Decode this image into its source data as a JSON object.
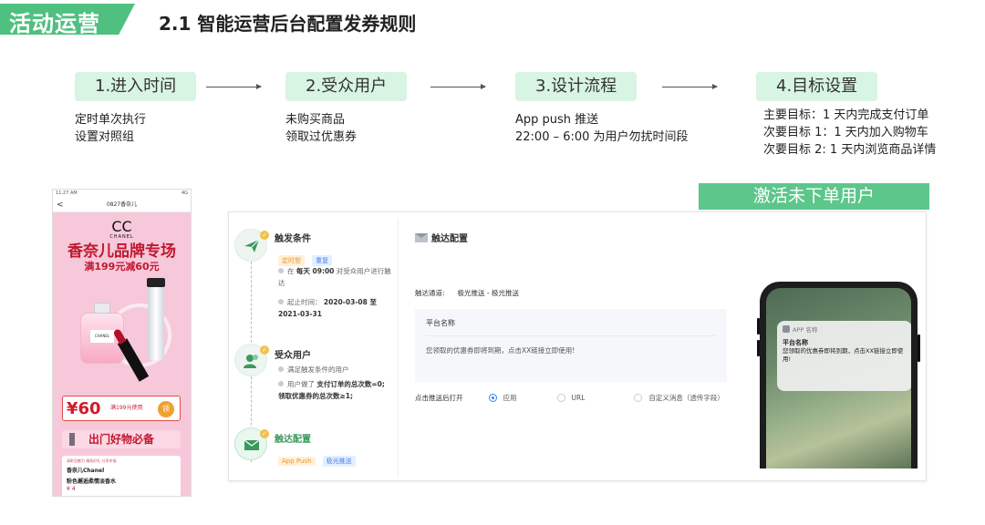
{
  "header": {
    "section_tag": "活动运营",
    "title": "2.1 智能运营后台配置发券规则"
  },
  "steps": [
    {
      "label": "1.进入时间",
      "lines": [
        "定时单次执行",
        "设置对照组"
      ]
    },
    {
      "label": "2.受众用户",
      "lines": [
        "未购买商品",
        "领取过优惠券"
      ]
    },
    {
      "label": "3.设计流程",
      "lines": [
        "App push 推送",
        "22:00 – 6:00 为用户勿扰时间段"
      ]
    },
    {
      "label": "4.目标设置",
      "lines": [
        "主要目标：1 天内完成支付订单",
        "次要目标 1：1 天内加入购物车",
        "次要目标 2: 1 天内浏览商品详情"
      ]
    }
  ],
  "banner": "激活未下单用户",
  "phone_shot": {
    "status_left": "11:27 AM",
    "status_right": "4G",
    "nav_title": "0827香奈儿",
    "back": "<",
    "logo_glyph": "CC",
    "logo_text": "CHANEL",
    "title": "香奈儿品牌专场",
    "subtitle": "满199元减60元",
    "bottle_label": "CHANEL",
    "coupon_amount": "¥60",
    "coupon_condition": "满199元使用",
    "coupon_button": "领",
    "strip": "出门好物必备",
    "card_top": "请彰显魅力 精致好礼 分享幸福",
    "card_name1": "香奈儿Chanel",
    "card_name2": "粉色邂逅柔情淡香水",
    "card_price": "¥ 4"
  },
  "config": {
    "trigger": {
      "title": "触发条件",
      "tags": [
        "定时型",
        "重复"
      ],
      "line1": "在",
      "line1_bold": "每天 09:00",
      "line1_rest": "对受众用户进行触达",
      "line2_label": "起止时间：",
      "line2_value": "2020-03-08 至 2021-03-31"
    },
    "audience": {
      "title": "受众用户",
      "line1": "满足触发条件的用户",
      "line2_prefix": "用户做了",
      "line2_bold": "支付订单的总次数=0; 领取优惠券的总次数≥1;"
    },
    "reach": {
      "title": "触达配置",
      "tags": [
        "App Push",
        "极光推送"
      ]
    },
    "detail": {
      "title": "触达配置",
      "channel_label": "触达通道:",
      "channel_value": "极光推送 - 极光推送",
      "platform_name": "平台名称",
      "message": "您领取的优惠券即将到期，点击XX链接立即使用!",
      "open_label": "点击推送后打开",
      "options": [
        "应用",
        "URL",
        "自定义消息（透传字段）"
      ],
      "selected": "应用"
    }
  },
  "phone": {
    "app_name": "APP 名称",
    "platform_name": "平台名称",
    "message": "您领取的优惠券即将到期，点击XX链接立即使用!"
  },
  "colors": {
    "accent": "#4fc07f",
    "pill_bg": "#d8f4e2",
    "brand_red": "#c0182f",
    "radio_blue": "#3b7ef0"
  }
}
